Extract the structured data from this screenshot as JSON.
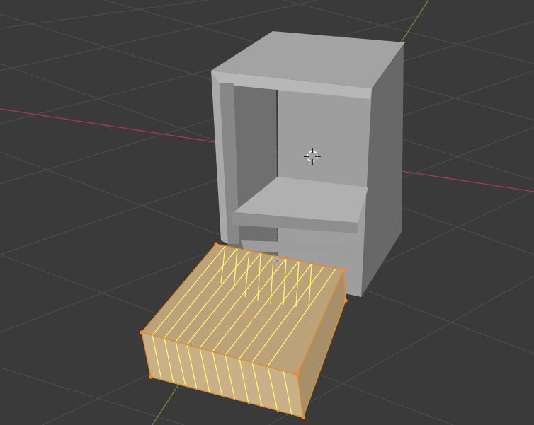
{
  "app": {
    "name": "3D viewport",
    "edit_mode": "edit",
    "selection_mode": "edge-loop"
  },
  "objects": [
    {
      "name": "cabinet",
      "selected": false
    },
    {
      "name": "drawer",
      "selected": true
    }
  ],
  "colors": {
    "viewport_bg": "#3a3a3a",
    "grid_line": "#4d4d4d",
    "axis_x": "#a8394f",
    "axis_y": "#6d8f2a",
    "object_gray": "#9a9a9a",
    "selected_face": "#bba27a",
    "selected_edge": "#ffff66",
    "selected_vertex": "#ff8b21"
  },
  "icons": {
    "object_origin": "origin-icon",
    "cursor_3d": "3d-cursor-icon",
    "mouse_cursor": "move-cursor-icon"
  }
}
